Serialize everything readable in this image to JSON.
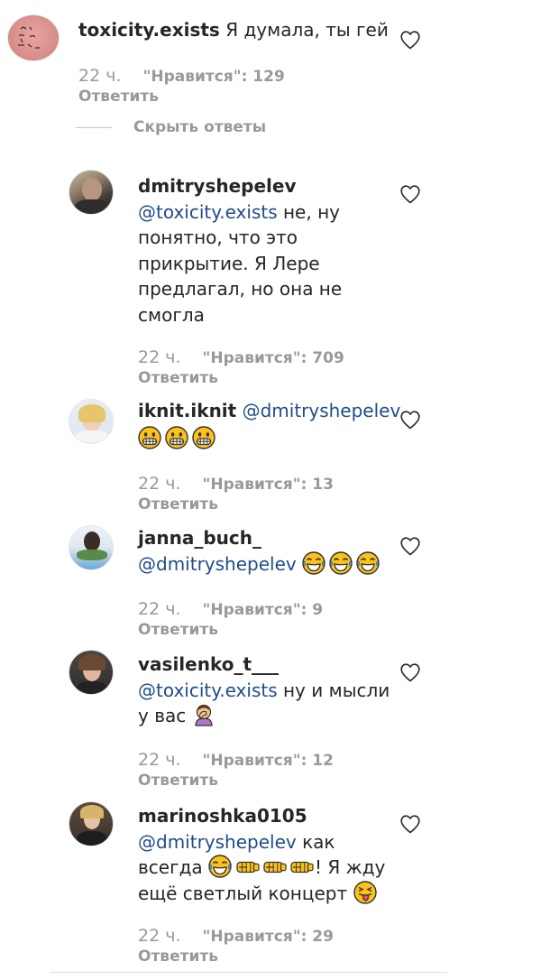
{
  "comments": [
    {
      "username": "toxicity.exists",
      "mention": "",
      "text": "Я думала, ты гей",
      "time": "22 ч.",
      "likes": "\"Нравится\": 129",
      "reply": "Ответить"
    },
    {
      "username": "dmitryshepelev",
      "mention": "@toxicity.exists",
      "text": "не, ну понятно, что это прикрытие. Я Лере предлагал, но она не смогла",
      "time": "22 ч.",
      "likes": "\"Нравится\": 709",
      "reply": "Ответить"
    },
    {
      "username": "iknit.iknit",
      "mention": "@dmitryshepelev",
      "text": "",
      "time": "22 ч.",
      "likes": "\"Нравится\": 13",
      "reply": "Ответить"
    },
    {
      "username": "janna_buch_",
      "mention": "@dmitryshepelev",
      "text": "",
      "time": "22 ч.",
      "likes": "\"Нравится\": 9",
      "reply": "Ответить"
    },
    {
      "username": "vasilenko_t___",
      "mention": "@toxicity.exists",
      "text": "ну и мысли у вас",
      "time": "22 ч.",
      "likes": "\"Нравится\": 12",
      "reply": "Ответить"
    },
    {
      "username": "marinoshka0105",
      "mention": "@dmitryshepelev",
      "text_part1": "как всегда",
      "text_part2": "! Я жду ещё светлый концерт",
      "time": "22 ч.",
      "likes": "\"Нравится\": 29",
      "reply": "Ответить"
    }
  ],
  "hide_replies_label": "Скрыть ответы",
  "avatar_text": "Toxicity Exists",
  "icons": {
    "like": "heart-outline-icon",
    "grin": "grinning-face-emoji",
    "tears": "tears-of-joy-emoji",
    "facepalm": "facepalm-emoji",
    "fist": "fist-bump-emoji",
    "tongue": "squinting-tongue-emoji"
  },
  "colors": {
    "text": "#262626",
    "muted": "#999999",
    "mention": "#1f4d8a",
    "divider": "#dbdbdb"
  }
}
